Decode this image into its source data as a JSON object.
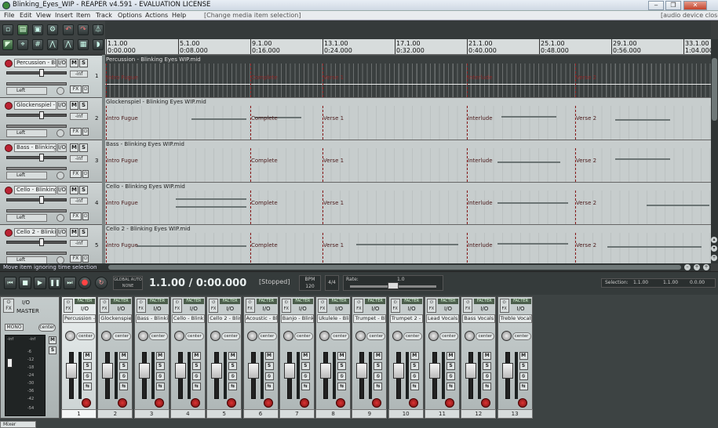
{
  "window": {
    "title": "Blinking_Eyes_WIP - REAPER v4.591 - EVALUATION LICENSE",
    "controls": [
      "‒",
      "❐",
      "✕"
    ]
  },
  "menu": {
    "items": [
      "File",
      "Edit",
      "View",
      "Insert",
      "Item",
      "Track",
      "Options",
      "Actions",
      "Help"
    ],
    "context": "[Change media item selection]",
    "audio_status": "[audio device closed]"
  },
  "ruler": {
    "marks": [
      {
        "bar": "1.1.00",
        "time": "0:00.000"
      },
      {
        "bar": "5.1.00",
        "time": "0:08.000"
      },
      {
        "bar": "9.1.00",
        "time": "0:16.000"
      },
      {
        "bar": "13.1.00",
        "time": "0:24.000"
      },
      {
        "bar": "17.1.00",
        "time": "0:32.000"
      },
      {
        "bar": "21.1.00",
        "time": "0:40.000"
      },
      {
        "bar": "25.1.00",
        "time": "0:48.000"
      },
      {
        "bar": "29.1.00",
        "time": "0:56.000"
      },
      {
        "bar": "33.1.00",
        "time": "1:04.000"
      }
    ]
  },
  "markers": [
    "Intro Fugue",
    "Complete",
    "Verse 1",
    "Interlude",
    "Verse 2"
  ],
  "tracks": [
    {
      "name": "Percussion - Blinkin",
      "number": "1",
      "volume": "-inf",
      "pan": "Left",
      "item": "Percussion - Blinking Eyes WIP.mid",
      "dark": true
    },
    {
      "name": "Glockenspiel - Blinki",
      "number": "2",
      "volume": "-inf",
      "pan": "Left",
      "item": "Glockenspiel - Blinking Eyes WIP.mid",
      "dark": false
    },
    {
      "name": "Bass - Blinking Eyes",
      "number": "3",
      "volume": "-inf",
      "pan": "Left",
      "item": "Bass - Blinking Eyes WIP.mid",
      "dark": false
    },
    {
      "name": "Cello - Blinking Eyes",
      "number": "4",
      "volume": "-inf",
      "pan": "Left",
      "item": "Cello - Blinking Eyes WIP.mid",
      "dark": false
    },
    {
      "name": "Cello 2 - Blinking Ey",
      "number": "5",
      "volume": "-inf",
      "pan": "Left",
      "item": "Cello 2 - Blinking Eyes WIP.mid",
      "dark": false
    }
  ],
  "track_labels": {
    "io": "I/O",
    "mute": "M",
    "solo": "S",
    "fx": "FX",
    "power": "⏻"
  },
  "status": {
    "message": "Move item ignoring time selection"
  },
  "transport": {
    "buttons": [
      "⏮",
      "■",
      "▶",
      "❚❚",
      "⏭",
      "●",
      "↻"
    ],
    "global_auto_label": "GLOBAL AUTO",
    "global_auto_value": "NONE",
    "position": "1.1.00 / 0:00.000",
    "state": "[Stopped]",
    "bpm_label": "BPM",
    "bpm": "120",
    "time_signature": "4/4",
    "rate_label": "Rate:",
    "rate_value": "1.0",
    "rate_fraction": 0.5,
    "selection_label": "Selection:",
    "selection_start": "1.1.00",
    "selection_end": "1.1.00",
    "selection_length": "0.0.00"
  },
  "mixer": {
    "master": {
      "fx": "FX",
      "io": "I/O",
      "name": "MASTER",
      "mono": "MONO",
      "pan": "center",
      "meter_labels": [
        "-inf",
        "-inf",
        "-6",
        "-12",
        "-18",
        "-24",
        "-30",
        "-36",
        "-42",
        "-54"
      ],
      "mute": "M",
      "solo": "S"
    },
    "strip_labels": {
      "fx": "FX",
      "fx_tag": "FACTER",
      "io": "I/O",
      "pan": "center",
      "mute": "M",
      "solo": "S",
      "phase": "⦸",
      "route": "⇆"
    },
    "strips": [
      {
        "name": "Percussion - E",
        "number": "1",
        "selected": true
      },
      {
        "name": "Glockenspiel",
        "number": "2",
        "selected": false
      },
      {
        "name": "Bass - Blinkin",
        "number": "3",
        "selected": false
      },
      {
        "name": "Cello - Blinkin",
        "number": "4",
        "selected": false
      },
      {
        "name": "Cello 2 - Blinki",
        "number": "5",
        "selected": false
      },
      {
        "name": "Acoustic - Blir",
        "number": "6",
        "selected": false
      },
      {
        "name": "Banjo - Blinkir",
        "number": "7",
        "selected": false
      },
      {
        "name": "Ukulele - Blink",
        "number": "8",
        "selected": false
      },
      {
        "name": "Trumpet - Blin",
        "number": "9",
        "selected": false
      },
      {
        "name": "Trumpet 2 - Bl",
        "number": "10",
        "selected": false
      },
      {
        "name": "Lead Vocals -",
        "number": "11",
        "selected": false
      },
      {
        "name": "Bass Vocals -",
        "number": "12",
        "selected": false
      },
      {
        "name": "Treble Vocals",
        "number": "13",
        "selected": false
      }
    ],
    "tab": "Mixer"
  }
}
